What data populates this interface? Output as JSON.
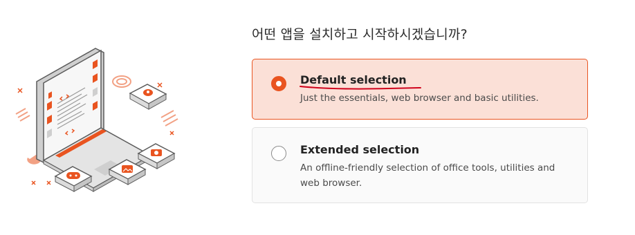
{
  "question": "어떤 앱을 설치하고 시작하시겠습니까?",
  "options": [
    {
      "title": "Default selection",
      "description": "Just the essentials, web browser and basic utilities.",
      "selected": true
    },
    {
      "title": "Extended selection",
      "description": "An offline-friendly selection of office tools, utilities and web browser.",
      "selected": false
    }
  ],
  "colors": {
    "accent": "#e95420",
    "selected_background": "#fbe0d7",
    "annotation_underline": "#d0021b"
  },
  "illustration": {
    "icon": "laptop-apps-illustration"
  }
}
